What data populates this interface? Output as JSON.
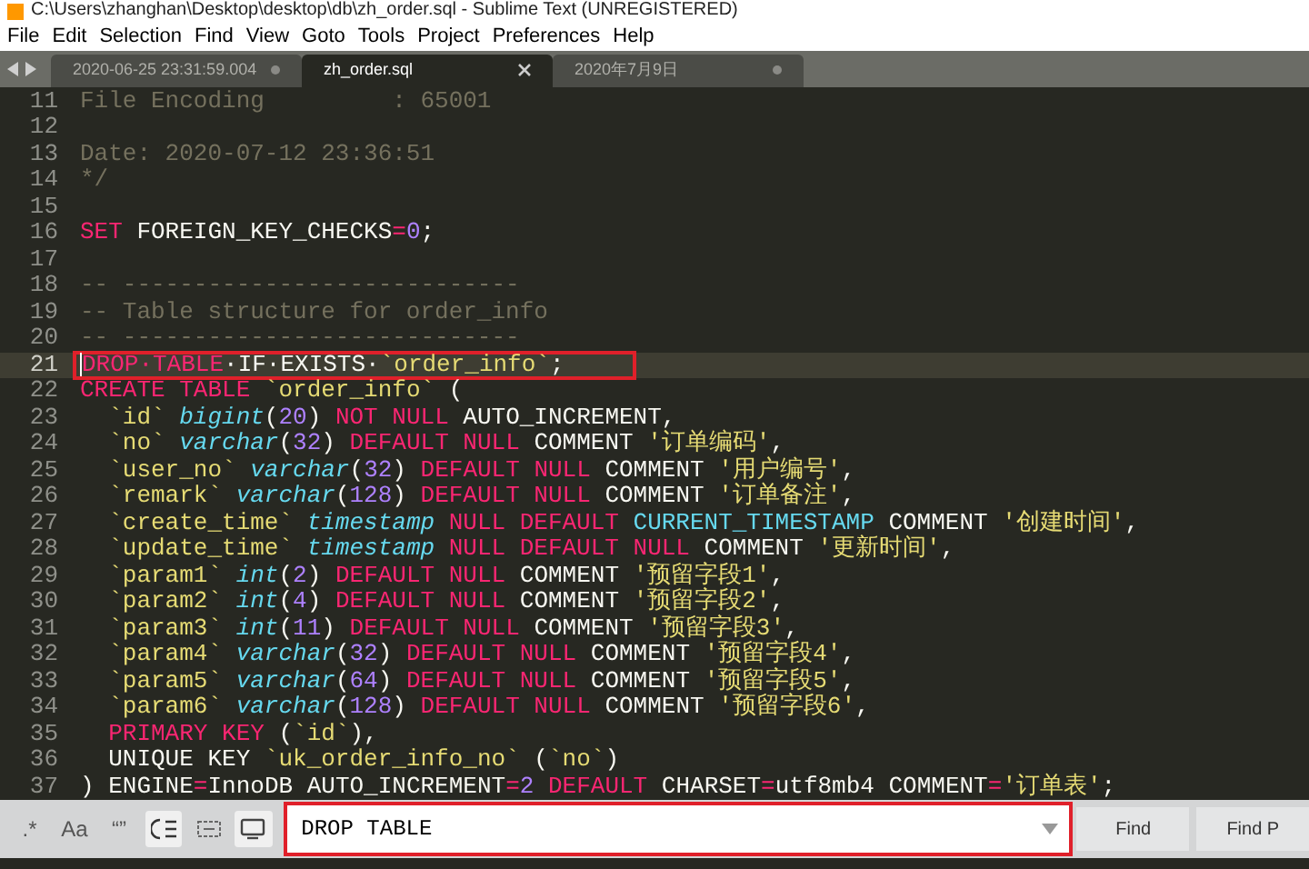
{
  "window": {
    "title": "C:\\Users\\zhanghan\\Desktop\\desktop\\db\\zh_order.sql - Sublime Text (UNREGISTERED)"
  },
  "menu": [
    "File",
    "Edit",
    "Selection",
    "Find",
    "View",
    "Goto",
    "Tools",
    "Project",
    "Preferences",
    "Help"
  ],
  "tabs": [
    {
      "label": "2020-06-25 23:31:59.004",
      "selected": false,
      "dirty": true
    },
    {
      "label": "zh_order.sql",
      "selected": true
    },
    {
      "label": "2020年7月9日",
      "selected": false,
      "dirty": true
    }
  ],
  "lines": [
    {
      "number": "11",
      "selected": false,
      "boxed": false,
      "tokens": [
        {
          "kind": "comment",
          "text": "File Encoding         : 65001"
        }
      ]
    },
    {
      "number": "12",
      "selected": false,
      "boxed": false
    },
    {
      "number": "13",
      "selected": false,
      "boxed": false,
      "tokens": [
        {
          "kind": "comment",
          "text": "Date: 2020-07-12 23:36:51"
        }
      ]
    },
    {
      "number": "14",
      "selected": false,
      "boxed": false,
      "tokens": [
        {
          "kind": "comment",
          "text": "*/"
        }
      ]
    },
    {
      "number": "15",
      "selected": false,
      "boxed": false
    },
    {
      "number": "16",
      "selected": false,
      "boxed": false,
      "tokens": [
        {
          "kind": "keyword",
          "text": "SET"
        },
        {
          "kind": "plain",
          "text": " FOREIGN_KEY_CHECKS"
        },
        {
          "kind": "keyword",
          "text": "="
        },
        {
          "kind": "number",
          "text": "0"
        },
        {
          "kind": "plain",
          "text": ";"
        }
      ]
    },
    {
      "number": "17",
      "selected": false,
      "boxed": false
    },
    {
      "number": "18",
      "selected": false,
      "boxed": false,
      "tokens": [
        {
          "kind": "comment",
          "text": "-- ----------------------------"
        }
      ]
    },
    {
      "number": "19",
      "selected": false,
      "boxed": false,
      "tokens": [
        {
          "kind": "comment",
          "text": "-- Table structure for order_info"
        }
      ]
    },
    {
      "number": "20",
      "selected": false,
      "boxed": false,
      "tokens": [
        {
          "kind": "comment",
          "text": "-- ----------------------------"
        }
      ]
    },
    {
      "number": "21",
      "selected": true,
      "boxed": true,
      "tokens": [
        {
          "kind": "keyword",
          "text": "DROP·TABLE"
        },
        {
          "kind": "plain",
          "text": "·IF·EXISTS·"
        },
        {
          "kind": "string",
          "text": "`order_info`"
        },
        {
          "kind": "plain",
          "text": ";"
        }
      ]
    },
    {
      "number": "22",
      "selected": false,
      "boxed": false,
      "tokens": [
        {
          "kind": "keyword",
          "text": "CREATE TABLE"
        },
        {
          "kind": "string",
          "text": " `order_info`"
        },
        {
          "kind": "plain",
          "text": " ("
        }
      ]
    },
    {
      "number": "23",
      "selected": false,
      "boxed": false,
      "tokens": [
        {
          "kind": "string",
          "text": "  `id`"
        },
        {
          "kind": "type",
          "text": " bigint"
        },
        {
          "kind": "plain",
          "text": "("
        },
        {
          "kind": "number",
          "text": "20"
        },
        {
          "kind": "plain",
          "text": ")"
        },
        {
          "kind": "keyword",
          "text": " NOT NULL"
        },
        {
          "kind": "plain",
          "text": " AUTO_INCREMENT,"
        }
      ]
    },
    {
      "number": "24",
      "selected": false,
      "boxed": false,
      "tokens": [
        {
          "kind": "string",
          "text": "  `no`"
        },
        {
          "kind": "type",
          "text": " varchar"
        },
        {
          "kind": "plain",
          "text": "("
        },
        {
          "kind": "number",
          "text": "32"
        },
        {
          "kind": "plain",
          "text": ")"
        },
        {
          "kind": "keyword",
          "text": " DEFAULT NULL"
        },
        {
          "kind": "plain",
          "text": " COMMENT "
        },
        {
          "kind": "string",
          "text": "'订单编码'"
        },
        {
          "kind": "plain",
          "text": ","
        }
      ]
    },
    {
      "number": "25",
      "selected": false,
      "boxed": false,
      "tokens": [
        {
          "kind": "string",
          "text": "  `user_no`"
        },
        {
          "kind": "type",
          "text": " varchar"
        },
        {
          "kind": "plain",
          "text": "("
        },
        {
          "kind": "number",
          "text": "32"
        },
        {
          "kind": "plain",
          "text": ")"
        },
        {
          "kind": "keyword",
          "text": " DEFAULT NULL"
        },
        {
          "kind": "plain",
          "text": " COMMENT "
        },
        {
          "kind": "string",
          "text": "'用户编号'"
        },
        {
          "kind": "plain",
          "text": ","
        }
      ]
    },
    {
      "number": "26",
      "selected": false,
      "boxed": false,
      "tokens": [
        {
          "kind": "string",
          "text": "  `remark`"
        },
        {
          "kind": "type",
          "text": " varchar"
        },
        {
          "kind": "plain",
          "text": "("
        },
        {
          "kind": "number",
          "text": "128"
        },
        {
          "kind": "plain",
          "text": ")"
        },
        {
          "kind": "keyword",
          "text": " DEFAULT NULL"
        },
        {
          "kind": "plain",
          "text": " COMMENT "
        },
        {
          "kind": "string",
          "text": "'订单备注'"
        },
        {
          "kind": "plain",
          "text": ","
        }
      ]
    },
    {
      "number": "27",
      "selected": false,
      "boxed": false,
      "tokens": [
        {
          "kind": "string",
          "text": "  `create_time`"
        },
        {
          "kind": "type",
          "text": " timestamp"
        },
        {
          "kind": "keyword",
          "text": " NULL DEFAULT"
        },
        {
          "kind": "constant",
          "text": " CURRENT_TIMESTAMP"
        },
        {
          "kind": "plain",
          "text": " COMMENT "
        },
        {
          "kind": "string",
          "text": "'创建时间'"
        },
        {
          "kind": "plain",
          "text": ","
        }
      ]
    },
    {
      "number": "28",
      "selected": false,
      "boxed": false,
      "tokens": [
        {
          "kind": "string",
          "text": "  `update_time`"
        },
        {
          "kind": "type",
          "text": " timestamp"
        },
        {
          "kind": "keyword",
          "text": " NULL DEFAULT NULL"
        },
        {
          "kind": "plain",
          "text": " COMMENT "
        },
        {
          "kind": "string",
          "text": "'更新时间'"
        },
        {
          "kind": "plain",
          "text": ","
        }
      ]
    },
    {
      "number": "29",
      "selected": false,
      "boxed": false,
      "tokens": [
        {
          "kind": "string",
          "text": "  `param1`"
        },
        {
          "kind": "type",
          "text": " int"
        },
        {
          "kind": "plain",
          "text": "("
        },
        {
          "kind": "number",
          "text": "2"
        },
        {
          "kind": "plain",
          "text": ")"
        },
        {
          "kind": "keyword",
          "text": " DEFAULT NULL"
        },
        {
          "kind": "plain",
          "text": " COMMENT "
        },
        {
          "kind": "string",
          "text": "'预留字段1'"
        },
        {
          "kind": "plain",
          "text": ","
        }
      ]
    },
    {
      "number": "30",
      "selected": false,
      "boxed": false,
      "tokens": [
        {
          "kind": "string",
          "text": "  `param2`"
        },
        {
          "kind": "type",
          "text": " int"
        },
        {
          "kind": "plain",
          "text": "("
        },
        {
          "kind": "number",
          "text": "4"
        },
        {
          "kind": "plain",
          "text": ")"
        },
        {
          "kind": "keyword",
          "text": " DEFAULT NULL"
        },
        {
          "kind": "plain",
          "text": " COMMENT "
        },
        {
          "kind": "string",
          "text": "'预留字段2'"
        },
        {
          "kind": "plain",
          "text": ","
        }
      ]
    },
    {
      "number": "31",
      "selected": false,
      "boxed": false,
      "tokens": [
        {
          "kind": "string",
          "text": "  `param3`"
        },
        {
          "kind": "type",
          "text": " int"
        },
        {
          "kind": "plain",
          "text": "("
        },
        {
          "kind": "number",
          "text": "11"
        },
        {
          "kind": "plain",
          "text": ")"
        },
        {
          "kind": "keyword",
          "text": " DEFAULT NULL"
        },
        {
          "kind": "plain",
          "text": " COMMENT "
        },
        {
          "kind": "string",
          "text": "'预留字段3'"
        },
        {
          "kind": "plain",
          "text": ","
        }
      ]
    },
    {
      "number": "32",
      "selected": false,
      "boxed": false,
      "tokens": [
        {
          "kind": "string",
          "text": "  `param4`"
        },
        {
          "kind": "type",
          "text": " varchar"
        },
        {
          "kind": "plain",
          "text": "("
        },
        {
          "kind": "number",
          "text": "32"
        },
        {
          "kind": "plain",
          "text": ")"
        },
        {
          "kind": "keyword",
          "text": " DEFAULT NULL"
        },
        {
          "kind": "plain",
          "text": " COMMENT "
        },
        {
          "kind": "string",
          "text": "'预留字段4'"
        },
        {
          "kind": "plain",
          "text": ","
        }
      ]
    },
    {
      "number": "33",
      "selected": false,
      "boxed": false,
      "tokens": [
        {
          "kind": "string",
          "text": "  `param5`"
        },
        {
          "kind": "type",
          "text": " varchar"
        },
        {
          "kind": "plain",
          "text": "("
        },
        {
          "kind": "number",
          "text": "64"
        },
        {
          "kind": "plain",
          "text": ")"
        },
        {
          "kind": "keyword",
          "text": " DEFAULT NULL"
        },
        {
          "kind": "plain",
          "text": " COMMENT "
        },
        {
          "kind": "string",
          "text": "'预留字段5'"
        },
        {
          "kind": "plain",
          "text": ","
        }
      ]
    },
    {
      "number": "34",
      "selected": false,
      "boxed": false,
      "tokens": [
        {
          "kind": "string",
          "text": "  `param6`"
        },
        {
          "kind": "type",
          "text": " varchar"
        },
        {
          "kind": "plain",
          "text": "("
        },
        {
          "kind": "number",
          "text": "128"
        },
        {
          "kind": "plain",
          "text": ")"
        },
        {
          "kind": "keyword",
          "text": " DEFAULT NULL"
        },
        {
          "kind": "plain",
          "text": " COMMENT "
        },
        {
          "kind": "string",
          "text": "'预留字段6'"
        },
        {
          "kind": "plain",
          "text": ","
        }
      ]
    },
    {
      "number": "35",
      "selected": false,
      "boxed": false,
      "tokens": [
        {
          "kind": "keyword",
          "text": "  PRIMARY KEY"
        },
        {
          "kind": "plain",
          "text": " ("
        },
        {
          "kind": "string",
          "text": "`id`"
        },
        {
          "kind": "plain",
          "text": "),"
        }
      ]
    },
    {
      "number": "36",
      "selected": false,
      "boxed": false,
      "tokens": [
        {
          "kind": "plain",
          "text": "  UNIQUE KEY "
        },
        {
          "kind": "string",
          "text": "`uk_order_info_no`"
        },
        {
          "kind": "plain",
          "text": " ("
        },
        {
          "kind": "string",
          "text": "`no`"
        },
        {
          "kind": "plain",
          "text": ")"
        }
      ]
    },
    {
      "number": "37",
      "selected": false,
      "boxed": false,
      "tokens": [
        {
          "kind": "plain",
          "text": ") ENGINE"
        },
        {
          "kind": "keyword",
          "text": "="
        },
        {
          "kind": "plain",
          "text": "InnoDB AUTO_INCREMENT"
        },
        {
          "kind": "keyword",
          "text": "="
        },
        {
          "kind": "number",
          "text": "2"
        },
        {
          "kind": "keyword",
          "text": " DEFAULT"
        },
        {
          "kind": "plain",
          "text": " CHARSET"
        },
        {
          "kind": "keyword",
          "text": "="
        },
        {
          "kind": "plain",
          "text": "utf8mb4 COMMENT"
        },
        {
          "kind": "keyword",
          "text": "="
        },
        {
          "kind": "string",
          "text": "'订单表'"
        },
        {
          "kind": "plain",
          "text": ";"
        }
      ]
    }
  ],
  "find_panel": {
    "options": [
      {
        "kind": "text",
        "label": ".*",
        "selected": false
      },
      {
        "kind": "text",
        "label": "Aa",
        "selected": false
      },
      {
        "kind": "text",
        "label": "“”",
        "selected": false
      },
      {
        "kind": "wrap",
        "selected": true
      },
      {
        "kind": "in_selection",
        "selected": false
      },
      {
        "kind": "highlight",
        "selected": true
      }
    ],
    "value": "DROP TABLE",
    "boxed": true,
    "buttons": [
      "Find",
      "Find P"
    ]
  }
}
